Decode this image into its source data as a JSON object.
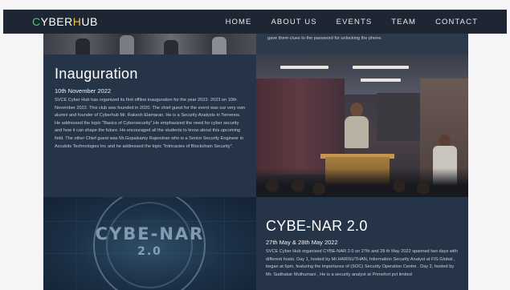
{
  "navbar": {
    "logo": {
      "part1": "C",
      "part2": "YBER",
      "part3": "H",
      "part4": "UB"
    },
    "links": [
      "HOME",
      "ABOUT US",
      "EVENTS",
      "TEAM",
      "CONTACT"
    ]
  },
  "top_strip": {
    "right_text": "gave them clues to the password for unlocking the phone."
  },
  "inauguration": {
    "title": "Inauguration",
    "date": "10th November 2022",
    "body": "SVCE Cyber Hub has organized its first offline inauguration for the year 2022- 2023 on 10th November 2022. This club was founded in 2020. The chief guest for the event was our very own alumni and founder of Cyberhub Mr. Rakesh Elamaran. He is a Security Analysts in Temenos. He addressed the topic \"Basics of Cybersecurity\".He emphasized the need for cyber security and how it can shape the future. He encouraged all the students to know about this upcoming field. The other Chief guest was Mr.Gopalsamy Rajendran who is a Senior Security Engineer in Accubits Technologies Inc and he addressed the topic \"Intricacies of Blockchain Security\"."
  },
  "graphic": {
    "line1": "CYBE-NAR",
    "line2": "2.0"
  },
  "cybenar": {
    "title": "CYBE-NAR 2.0",
    "date": "27th May & 28th May 2022",
    "body": "SVCE Cyber Hub organised CYBE-NAR 2.0 on 27th and 28 th May 2022 spanned two days with different hosts. Day 1, hosted by Mr.HARISUTHAN, Information Security Analyst at FIS Global , began at 6pm, featuring the importance of (SOC) Security Operation Centre . Day 2, hosted by Mr. Sudhakar Muthumani , He is a security analyst at Primefort pvt limited"
  },
  "colors": {
    "navbar_bg": "#1f2633",
    "logo_green": "#38d46a",
    "logo_yellow": "#f2c438",
    "panel_bg": "#263448"
  }
}
